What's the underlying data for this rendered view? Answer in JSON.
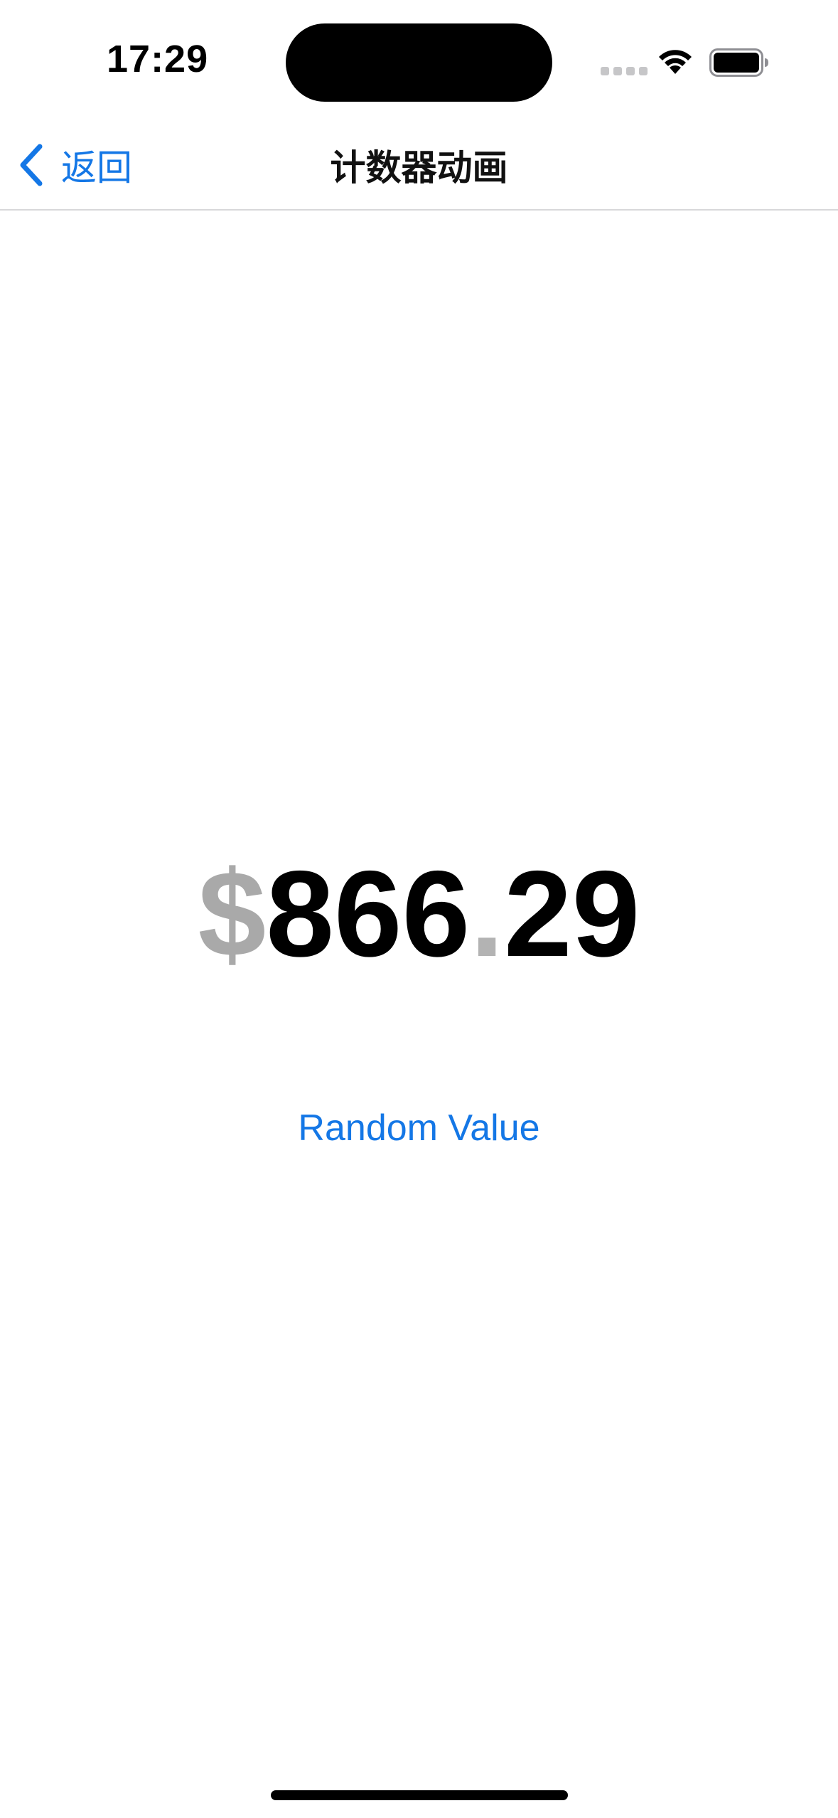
{
  "status_bar": {
    "time": "17:29",
    "icons": [
      "signal-dots-icon",
      "wifi-icon",
      "battery-icon"
    ]
  },
  "nav": {
    "back_label": "返回",
    "title": "计数器动画"
  },
  "counter": {
    "currency_symbol": "$",
    "integer_part": "866",
    "decimal_point": ".",
    "fraction_part": "29"
  },
  "actions": {
    "random_label": "Random Value"
  },
  "colors": {
    "accent": "#1477e6",
    "muted": "#a9a9a9"
  }
}
